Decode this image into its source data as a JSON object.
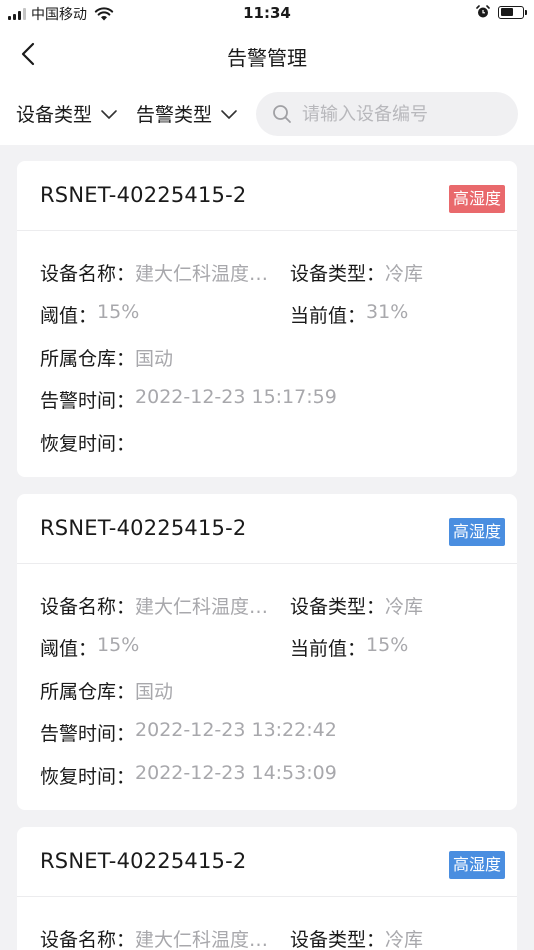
{
  "status_bar": {
    "carrier": "中国移动",
    "time": "11:34",
    "battery_level": 0.6
  },
  "nav": {
    "title": "告警管理"
  },
  "filters": {
    "device_type_label": "设备类型",
    "alarm_type_label": "告警类型",
    "search_placeholder": "请输入设备编号"
  },
  "labels": {
    "device_name": "设备名称：",
    "device_type": "设备类型：",
    "threshold": "阈值：",
    "current_value": "当前值：",
    "warehouse": "所属仓库：",
    "alarm_time": "告警时间：",
    "recovery_time": "恢复时间："
  },
  "cards": [
    {
      "device_id": "RSNET-40225415-2",
      "tag": "高湿度",
      "tag_color": "#e9696c",
      "device_name": "建大仁科温度…",
      "device_type": "冷库",
      "threshold": "15%",
      "current_value": "31%",
      "warehouse": "国动",
      "alarm_time": "2022-12-23 15:17:59",
      "recovery_time": ""
    },
    {
      "device_id": "RSNET-40225415-2",
      "tag": "高湿度",
      "tag_color": "#4a8ee0",
      "device_name": "建大仁科温度…",
      "device_type": "冷库",
      "threshold": "15%",
      "current_value": "15%",
      "warehouse": "国动",
      "alarm_time": "2022-12-23 13:22:42",
      "recovery_time": "2022-12-23 14:53:09"
    },
    {
      "device_id": "RSNET-40225415-2",
      "tag": "高湿度",
      "tag_color": "#4a8ee0",
      "device_name": "建大仁科温度…",
      "device_type": "冷库"
    }
  ]
}
